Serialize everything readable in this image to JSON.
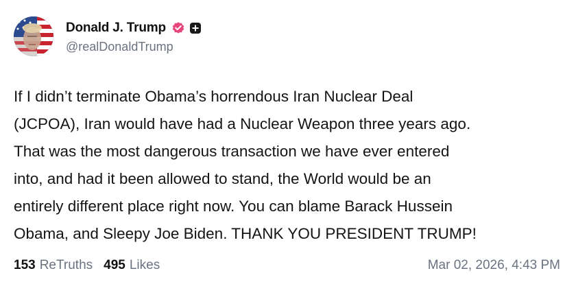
{
  "author": {
    "display_name": "Donald J. Trump",
    "handle": "@realDonaldTrump",
    "verified_color": "#e8457e",
    "avatar": "avatar-flag-portrait"
  },
  "post": {
    "lines": [
      "If I didn’t terminate Obama’s horrendous Iran Nuclear Deal",
      "(JCPOA), Iran would have had a Nuclear Weapon three years ago.",
      "That was the most dangerous transaction we have ever entered",
      "into, and had it been allowed to stand, the World would be an",
      "entirely different place right now. You can blame Barack Hussein",
      "Obama, and Sleepy Joe Biden. THANK YOU PRESIDENT TRUMP!"
    ]
  },
  "stats": {
    "retruths_count": "153",
    "retruths_label": "ReTruths",
    "likes_count": "495",
    "likes_label": "Likes"
  },
  "timestamp": "Mar 02, 2026, 4:43 PM",
  "icons": {
    "verified": "verified-badge-icon",
    "plus": "plus-badge-icon"
  }
}
